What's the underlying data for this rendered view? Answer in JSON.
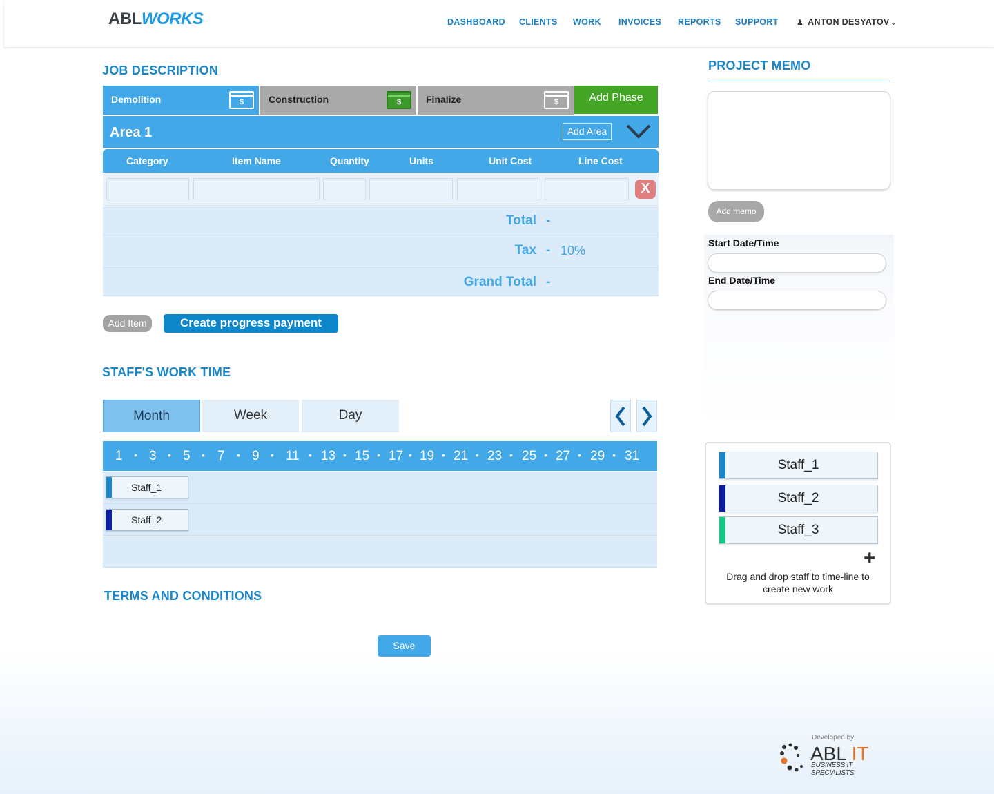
{
  "header": {
    "logo_part1": "ABL",
    "logo_part2": "WORKS",
    "nav": [
      "DASHBOARD",
      "CLIENTS",
      "WORK",
      "INVOICES",
      "REPORTS",
      "SUPPORT"
    ],
    "user_name": "ANTON DESYATOV",
    "user_icon": "person-icon",
    "user_chevron": "⌄"
  },
  "job": {
    "title": "JOB DESCRIPTION",
    "phases": [
      {
        "label": "Demolition",
        "state": "active",
        "icon": "money-icon"
      },
      {
        "label": "Construction",
        "state": "inactive",
        "icon": "money-icon-green"
      },
      {
        "label": "Finalize",
        "state": "inactive",
        "icon": "money-icon"
      }
    ],
    "money_symbol": "$",
    "add_phase_label": "Add Phase",
    "area_title": "Area 1",
    "add_area_label": "Add Area",
    "columns": [
      "Category",
      "Item Name",
      "Quantity",
      "Units",
      "Unit Cost",
      "Line Cost"
    ],
    "row_values": [
      "",
      "",
      "",
      "",
      "",
      ""
    ],
    "delete_label": "X",
    "total_label": "Total",
    "total_value": "-",
    "tax_label": "Tax",
    "tax_dash": "-",
    "tax_value": "10%",
    "grand_total_label": "Grand Total",
    "grand_total_value": "-",
    "add_item_label": "Add Item",
    "progress_payment_label": "Create progress payment"
  },
  "work_time": {
    "title": "STAFF'S WORK TIME",
    "views": [
      {
        "label": "Month",
        "state": "active"
      },
      {
        "label": "Week",
        "state": "inactive"
      },
      {
        "label": "Day",
        "state": "inactive"
      }
    ],
    "days": [
      "1",
      "3",
      "5",
      "7",
      "9",
      "11",
      "13",
      "15",
      "17",
      "19",
      "21",
      "23",
      "25",
      "27",
      "29",
      "31"
    ],
    "separator": "•",
    "rows": [
      {
        "name": "Staff_1",
        "color": "#1b86c8"
      },
      {
        "name": "Staff_2",
        "color": "#0d1fa0"
      }
    ]
  },
  "terms": {
    "title": "TERMS AND CONDITIONS"
  },
  "save_label": "Save",
  "memo": {
    "title": "PROJECT MEMO",
    "text": "",
    "add_label": "Add memo",
    "start_label": "Start Date/Time",
    "start_value": "",
    "end_label": "End Date/Time",
    "end_value": ""
  },
  "staff_pool": {
    "items": [
      {
        "name": "Staff_1",
        "color": "#1b86c8"
      },
      {
        "name": "Staff_2",
        "color": "#0d1fa0"
      },
      {
        "name": "Staff_3",
        "color": "#18c786"
      }
    ],
    "add_symbol": "+",
    "hint": "Drag and drop staff to time-line to create new work"
  },
  "footer": {
    "developed_by": "Developed by",
    "brand_name_1": "ABL",
    "brand_name_2": "IT",
    "brand_tagline": "BUSINESS IT SPECIALISTS"
  },
  "colors": {
    "accent": "#42a8e8",
    "title_blue": "#1b86c8",
    "add_phase_green": "#44a426"
  }
}
